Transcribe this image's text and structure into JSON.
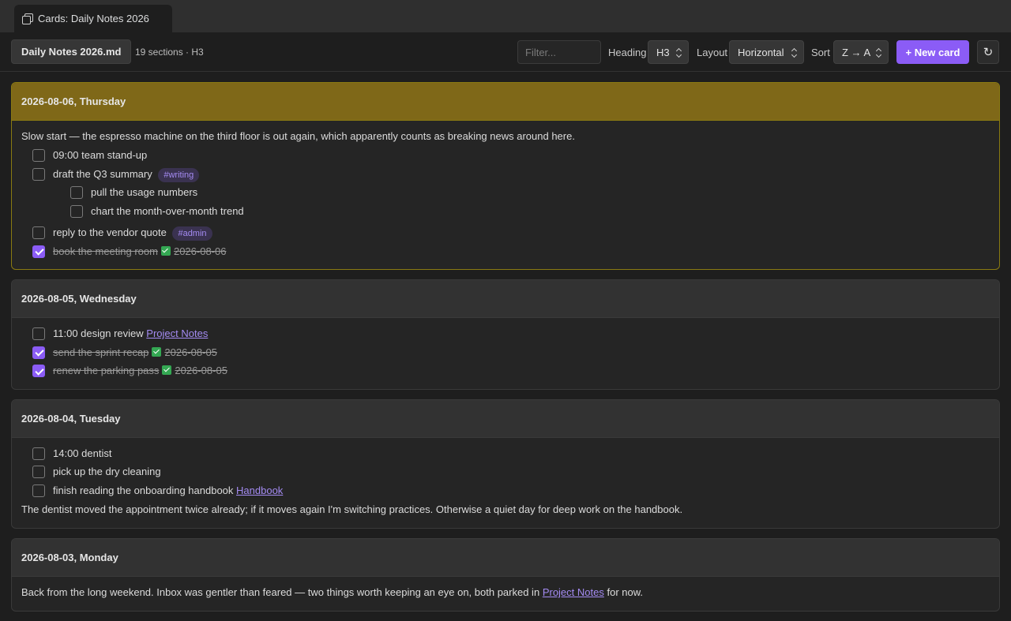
{
  "tab": {
    "title": "Cards: Daily Notes 2026",
    "icon": "cards-icon"
  },
  "toolbar": {
    "file": "Daily Notes 2026.md",
    "meta": "19 sections · H3",
    "filter_placeholder": "Filter...",
    "heading_label": "Heading",
    "heading_value": "H3",
    "layout_label": "Layout",
    "layout_value": "Horizontal",
    "sort_label": "Sort",
    "sort_value": "Z → A",
    "new_card": "+ New card",
    "refresh_icon": "↻"
  },
  "cards": [
    {
      "title": "2026-08-06, Thursday",
      "intro": "Slow start — the espresso machine on the third floor is out again, which apparently counts as breaking news around here.",
      "tasks": [
        {
          "text": "09:00 team stand-up",
          "done": false,
          "level": 1
        },
        {
          "text": "draft the Q3 summary",
          "tag": "#writing",
          "done": false,
          "level": 1
        },
        {
          "text": "pull the usage numbers",
          "done": false,
          "level": 2
        },
        {
          "text": "chart the month-over-month trend",
          "done": false,
          "level": 2
        },
        {
          "text": "reply to the vendor quote",
          "tag": "#admin",
          "done": false,
          "level": 1
        },
        {
          "text": "book the meeting room",
          "done": true,
          "date": "2026-08-06",
          "level": 1
        }
      ]
    },
    {
      "title": "2026-08-05, Wednesday",
      "tasks": [
        {
          "text": "11:00 design review",
          "link": "Project Notes",
          "done": false,
          "level": 1
        },
        {
          "text": "send the sprint recap",
          "done": true,
          "date": "2026-08-05",
          "level": 1
        },
        {
          "text": "renew the parking pass",
          "done": true,
          "date": "2026-08-05",
          "level": 1
        }
      ]
    },
    {
      "title": "2026-08-04, Tuesday",
      "tasks": [
        {
          "text": "14:00 dentist",
          "done": false,
          "level": 1
        },
        {
          "text": "pick up the dry cleaning",
          "done": false,
          "level": 1
        },
        {
          "text": "finish reading the onboarding handbook",
          "link": "Handbook",
          "done": false,
          "level": 1
        }
      ],
      "outro": "The dentist moved the appointment twice already; if it moves again I'm switching practices. Otherwise a quiet day for deep work on the handbook."
    },
    {
      "title": "2026-08-03, Monday",
      "intro_before_link": "Back from the long weekend. Inbox was gentler than feared — two things worth keeping an eye on, both parked in",
      "intro_link": "Project Notes",
      "intro_after_link": "for now."
    }
  ],
  "colors": {
    "accent": "#8b5cf6",
    "active_header": "#7f6818",
    "done_mark": "#34a853"
  }
}
